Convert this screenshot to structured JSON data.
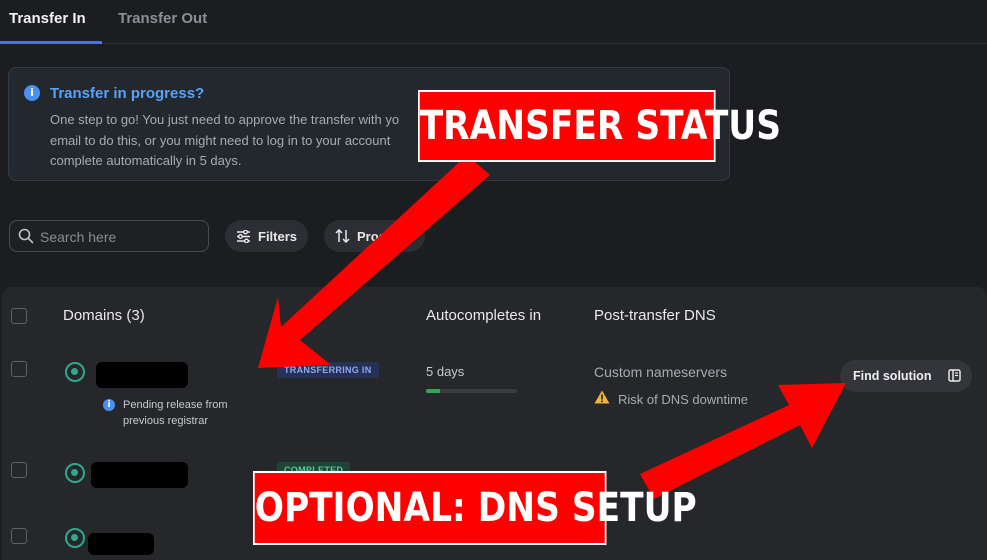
{
  "tabs": {
    "transfer_in": "Transfer In",
    "transfer_out": "Transfer Out"
  },
  "info": {
    "title": "Transfer in progress?",
    "body_line1": "One step to go! You just need to approve the transfer with yo",
    "body_line2": "email to do this, or you might need to log in to your account",
    "body_line3": "complete automatically in 5 days."
  },
  "search": {
    "placeholder": "Search here"
  },
  "toolbar": {
    "filters_label": "Filters",
    "progress_label": "Progress"
  },
  "table": {
    "headers": {
      "domains": "Domains (3)",
      "autocompletes": "Autocompletes in",
      "dns": "Post-transfer DNS"
    },
    "rows": [
      {
        "status": "TRANSFERRING IN",
        "pending_line1": "Pending release from",
        "pending_line2": "previous registrar",
        "autocomplete": "5 days",
        "progress": 0.15,
        "dns": "Custom nameservers",
        "dns_warning": "Risk of DNS downtime",
        "action": "Find solution"
      },
      {
        "status": "COMPLETED"
      },
      {
        "status": ""
      }
    ]
  },
  "annotations": {
    "status": "TRANSFER STATUS",
    "dns": "OPTIONAL: DNS SETUP"
  },
  "colors": {
    "accent": "#4f6df0",
    "annotation": "#ff0000",
    "success": "#2fa88f"
  }
}
